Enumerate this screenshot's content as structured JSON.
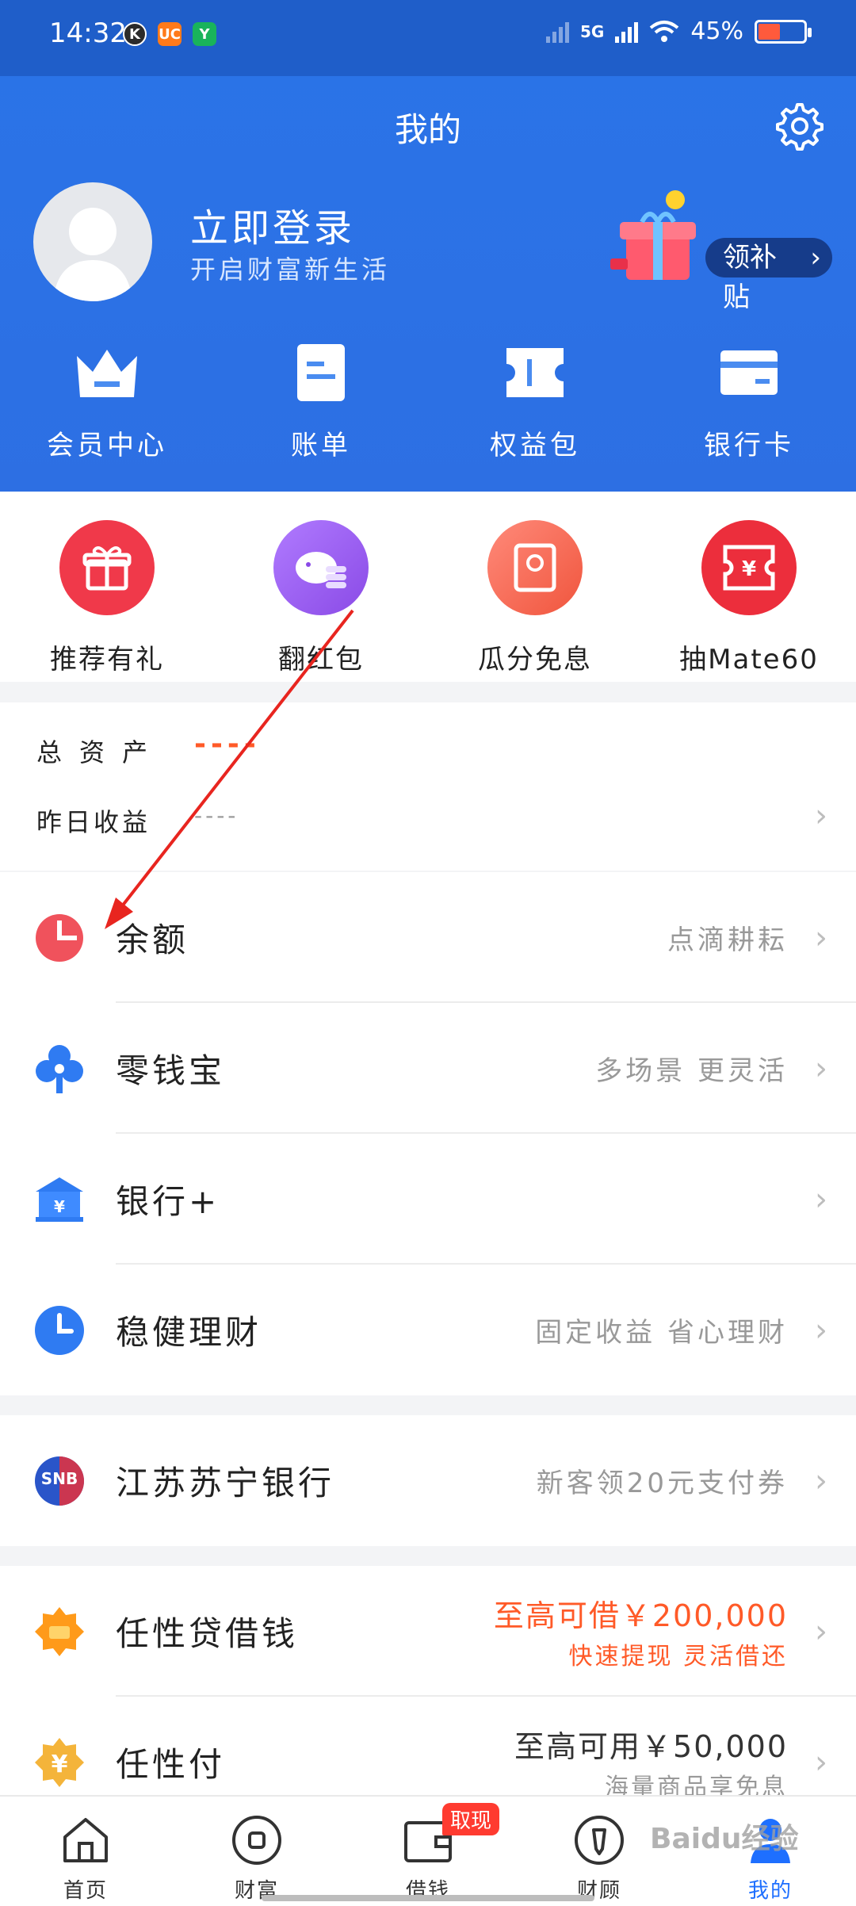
{
  "status_bar": {
    "time": "14:32",
    "network": "5G",
    "battery": "45%",
    "battery_level": 0.45,
    "apps": [
      "K",
      "UC",
      "Y"
    ]
  },
  "header": {
    "title": "我的",
    "login_title": "立即登录",
    "login_subtitle": "开启财富新生活",
    "subsidy_label": "领补贴"
  },
  "quick_actions": [
    {
      "label": "会员中心",
      "icon": "crown-icon"
    },
    {
      "label": "账单",
      "icon": "bill-icon"
    },
    {
      "label": "权益包",
      "icon": "ticket-icon"
    },
    {
      "label": "银行卡",
      "icon": "card-icon"
    }
  ],
  "promos": [
    {
      "label": "推荐有礼",
      "icon": "gift-icon",
      "color": "#f0394a"
    },
    {
      "label": "翻红包",
      "icon": "piggy-bank-icon",
      "color": "#9a5cf0"
    },
    {
      "label": "瓜分免息",
      "icon": "red-envelope-icon",
      "color": "#f4644f"
    },
    {
      "label": "抽Mate60",
      "icon": "coupon-icon",
      "color": "#ec2e3c"
    }
  ],
  "assets": {
    "total_label": "总资产",
    "total_value": "----",
    "yesterday_label": "昨日收益",
    "yesterday_value": "----"
  },
  "list1": [
    {
      "name": "余额",
      "desc": "点滴耕耘",
      "icon": "pie-chart-icon"
    },
    {
      "name": "零钱宝",
      "desc": "多场景 更灵活",
      "icon": "clover-icon"
    },
    {
      "name": "银行+",
      "desc": "",
      "icon": "bank-icon"
    },
    {
      "name": "稳健理财",
      "desc": "固定收益 省心理财",
      "icon": "clock-icon"
    }
  ],
  "bank": {
    "name": "江苏苏宁银行",
    "desc": "新客领20元支付券",
    "logo": "SNB"
  },
  "loans": [
    {
      "name": "任性贷借钱",
      "line1": "至高可借￥200,000",
      "line2": "快速提现 灵活借还",
      "icon": "loan-icon"
    },
    {
      "name": "任性付",
      "line1": "至高可用￥50,000",
      "line2": "海量商品享免息",
      "icon": "pay-icon"
    }
  ],
  "bottom_nav": [
    {
      "label": "首页",
      "icon": "home-icon"
    },
    {
      "label": "财富",
      "icon": "wealth-icon"
    },
    {
      "label": "借钱",
      "icon": "wallet-icon",
      "badge": "取现"
    },
    {
      "label": "财顾",
      "icon": "advisor-icon"
    },
    {
      "label": "我的",
      "icon": "profile-icon",
      "active": true
    }
  ],
  "watermark": "Baidu经验",
  "colors": {
    "brand_blue": "#2a74e8",
    "orange": "#ff5a28"
  }
}
